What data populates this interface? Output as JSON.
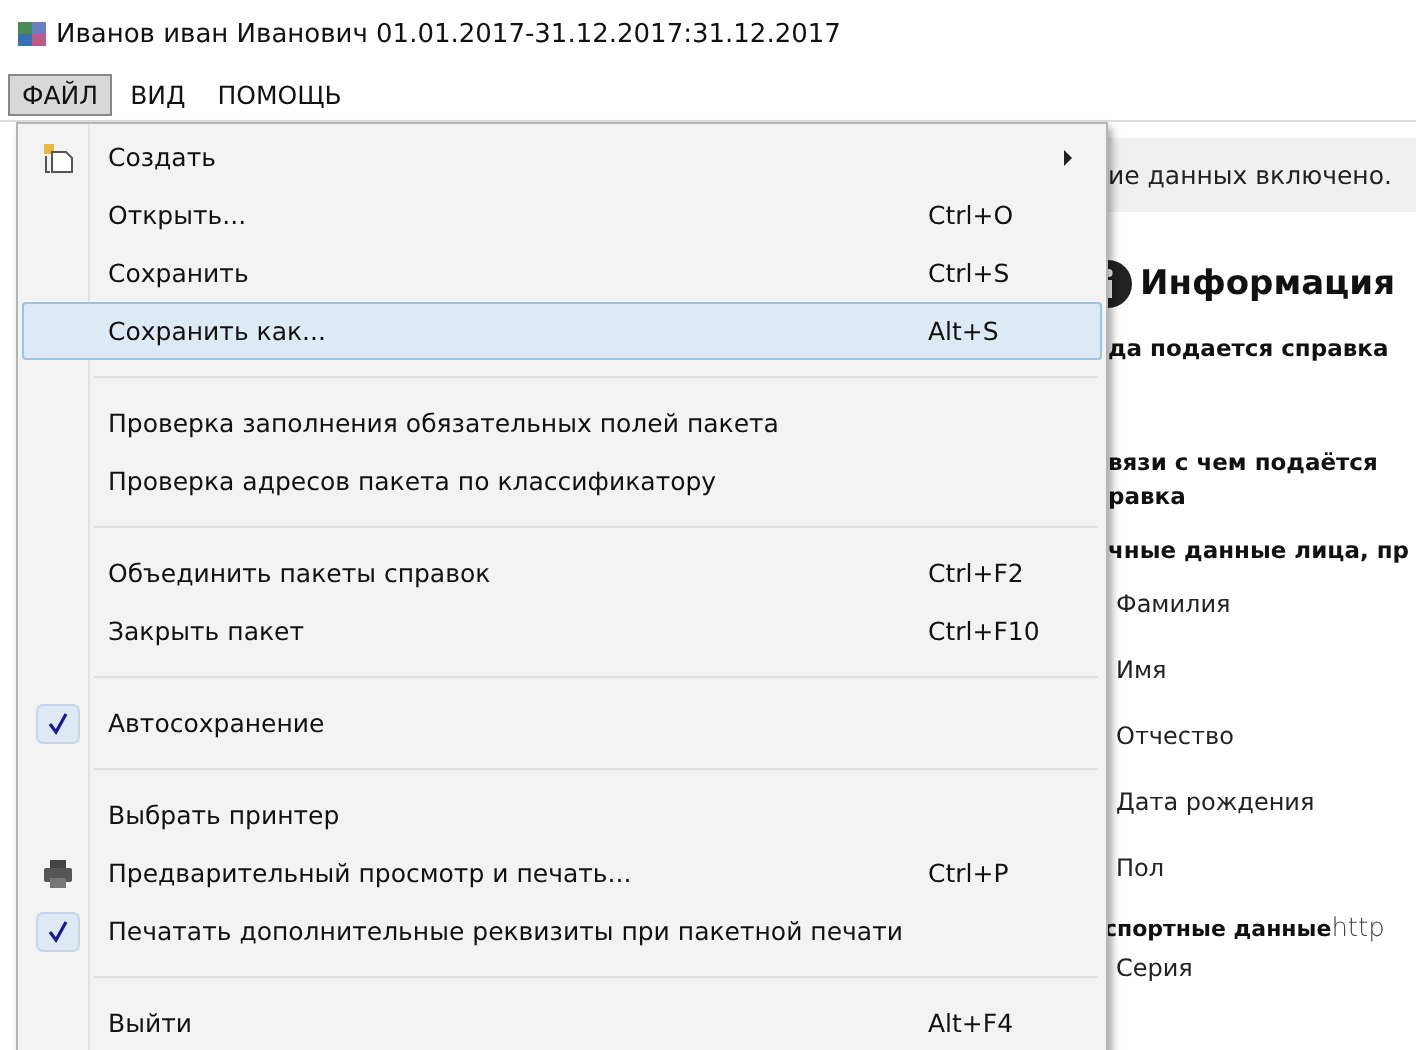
{
  "window": {
    "title": "Иванов иван Иванович 01.01.2017-31.12.2017:31.12.2017"
  },
  "menubar": [
    {
      "label": "ФАЙЛ",
      "selected": true
    },
    {
      "label": "ВИД",
      "selected": false
    },
    {
      "label": "ПОМОЩЬ",
      "selected": false
    }
  ],
  "file_menu": [
    {
      "kind": "submenu",
      "label": "Создать",
      "checked": false,
      "selected": false
    },
    {
      "kind": "item",
      "label": "Открыть...",
      "shortcut": "Ctrl+O",
      "checked": false,
      "selected": false
    },
    {
      "kind": "item",
      "label": "Сохранить",
      "shortcut": "Ctrl+S",
      "checked": false,
      "selected": false
    },
    {
      "kind": "item",
      "label": "Сохранить как...",
      "shortcut": "Alt+S",
      "checked": false,
      "selected": true
    },
    {
      "kind": "separator"
    },
    {
      "kind": "item",
      "label": "Проверка заполнения обязательных полей пакета",
      "checked": false,
      "selected": false
    },
    {
      "kind": "item",
      "label": "Проверка адресов пакета по классификатору",
      "checked": false,
      "selected": false
    },
    {
      "kind": "separator"
    },
    {
      "kind": "item",
      "label": "Объединить пакеты справок",
      "shortcut": "Ctrl+F2",
      "checked": false,
      "selected": false
    },
    {
      "kind": "item",
      "label": "Закрыть пакет",
      "shortcut": "Ctrl+F10",
      "checked": false,
      "selected": false
    },
    {
      "kind": "separator"
    },
    {
      "kind": "item",
      "label": "Автосохранение",
      "checked": true,
      "selected": false
    },
    {
      "kind": "separator"
    },
    {
      "kind": "item",
      "label": "Выбрать принтер",
      "checked": false,
      "selected": false
    },
    {
      "kind": "print",
      "label": "Предварительный просмотр и печать...",
      "shortcut": "Ctrl+P",
      "checked": false,
      "selected": false
    },
    {
      "kind": "item",
      "label": "Печатать дополнительные реквизиты при пакетной печати",
      "checked": true,
      "selected": false
    },
    {
      "kind": "separator"
    },
    {
      "kind": "item",
      "label": "Выйти",
      "shortcut": "Alt+F4",
      "checked": false,
      "selected": false
    }
  ],
  "panel": {
    "notice": "ие данных включено.",
    "heading": "Информация",
    "content": [
      {
        "kind": "section",
        "text": "да подается справка"
      },
      {
        "kind": "section_gap",
        "text": "вязи с чем подаётся равка"
      },
      {
        "kind": "section",
        "text": "чные данные лица, пр"
      },
      {
        "kind": "field",
        "text": "Фамилия"
      },
      {
        "kind": "field",
        "text": "Имя"
      },
      {
        "kind": "field",
        "text": "Отчество"
      },
      {
        "kind": "field",
        "text": "Дата рождения"
      },
      {
        "kind": "field",
        "text": "Пол"
      },
      {
        "kind": "section_link",
        "text": "спортные данные",
        "link": "http"
      },
      {
        "kind": "field_small",
        "text": "Серия"
      }
    ]
  }
}
